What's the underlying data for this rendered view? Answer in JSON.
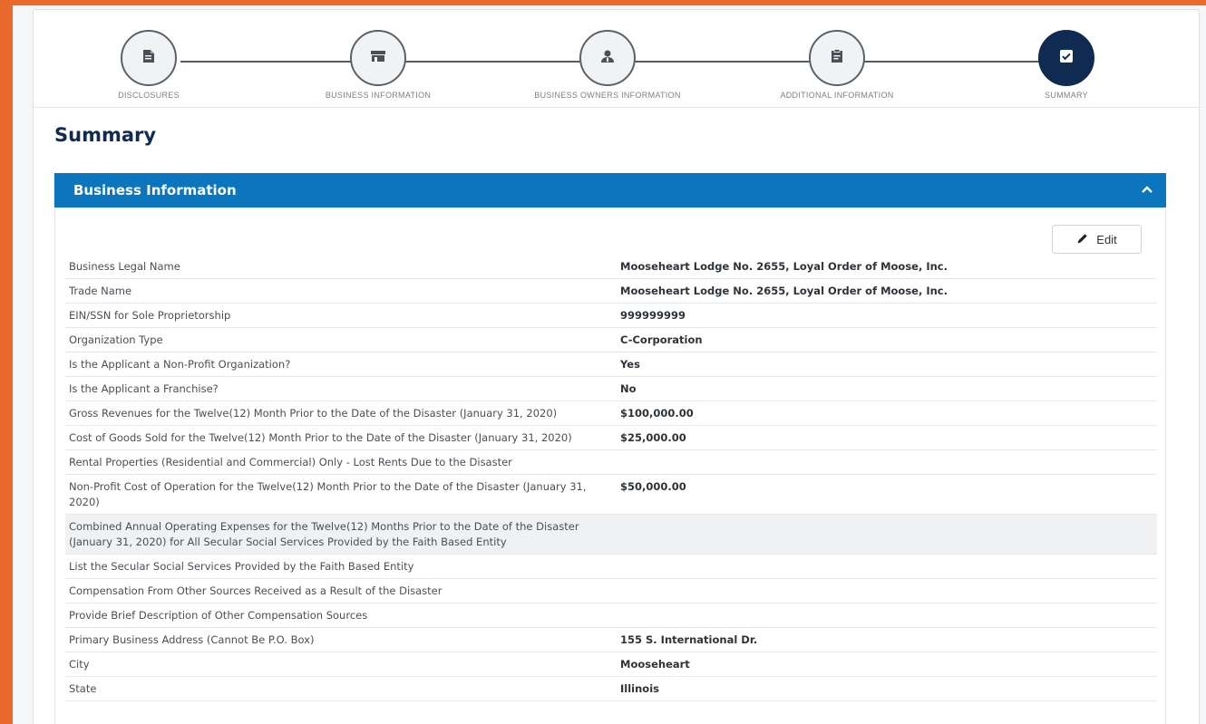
{
  "stepper": {
    "steps": [
      {
        "label": "DISCLOSURES",
        "icon": "document-icon"
      },
      {
        "label": "BUSINESS INFORMATION",
        "icon": "storefront-icon"
      },
      {
        "label": "BUSINESS OWNERS INFORMATION",
        "icon": "user-tie-icon"
      },
      {
        "label": "ADDITIONAL INFORMATION",
        "icon": "clipboard-icon"
      },
      {
        "label": "SUMMARY",
        "icon": "checkbox-icon"
      }
    ]
  },
  "summary": {
    "title": "Summary",
    "section_title": "Business Information",
    "edit_label": "Edit",
    "fields": [
      {
        "label": "Business Legal Name",
        "value": "Mooseheart Lodge No. 2655, Loyal Order of Moose, Inc."
      },
      {
        "label": "Trade Name",
        "value": "Mooseheart Lodge No. 2655, Loyal Order of Moose, Inc."
      },
      {
        "label": "EIN/SSN for Sole Proprietorship",
        "value": "999999999"
      },
      {
        "label": "Organization Type",
        "value": "C-Corporation"
      },
      {
        "label": "Is the Applicant a Non-Profit Organization?",
        "value": "Yes"
      },
      {
        "label": "Is the Applicant a Franchise?",
        "value": "No"
      },
      {
        "label": "Gross Revenues for the Twelve(12) Month Prior to the Date of the Disaster (January 31, 2020)",
        "value": "$100,000.00"
      },
      {
        "label": "Cost of Goods Sold for the Twelve(12) Month Prior to the Date of the Disaster (January 31, 2020)",
        "value": "$25,000.00"
      },
      {
        "label": "Rental Properties (Residential and Commercial) Only - Lost Rents Due to the Disaster",
        "value": ""
      },
      {
        "label": "Non-Profit Cost of Operation for the Twelve(12) Month Prior to the Date of the Disaster (January 31, 2020)",
        "value": "$50,000.00"
      },
      {
        "label": "Combined Annual Operating Expenses for the Twelve(12) Months Prior to the Date of the Disaster (January 31, 2020) for All Secular Social Services Provided by the Faith Based Entity",
        "value": ""
      },
      {
        "label": "List the Secular Social Services Provided by the Faith Based Entity",
        "value": ""
      },
      {
        "label": "Compensation From Other Sources Received as a Result of the Disaster",
        "value": ""
      },
      {
        "label": "Provide Brief Description of Other Compensation Sources",
        "value": ""
      },
      {
        "label": "Primary Business Address (Cannot Be P.O. Box)",
        "value": "155 S. International Dr."
      },
      {
        "label": "City",
        "value": "Mooseheart"
      },
      {
        "label": "State",
        "value": "Illinois"
      }
    ]
  }
}
